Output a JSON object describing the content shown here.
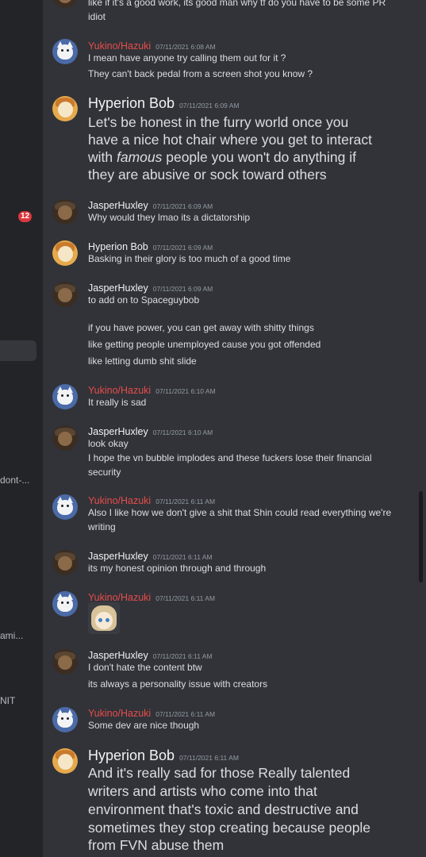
{
  "sidebar": {
    "badge": "12",
    "labels": [
      "dont-...",
      "ami...",
      "NIT"
    ]
  },
  "colors": {
    "yukino": "#e74c4c",
    "default_name": "#f2f3f5",
    "timestamp": "#949ba4",
    "background": "#313338"
  },
  "messages": [
    {
      "id": "m0",
      "author": "",
      "timestamp": "",
      "lines": [
        "like if it's a good work, its good man why tf do you have to be some PR",
        "idiot"
      ],
      "big": false,
      "avatar": "jasper-avatar"
    },
    {
      "id": "m1",
      "author": "Yukino/Hazuki",
      "timestamp": "07/11/2021 6:08 AM",
      "lines": [
        "I mean have anyone try calling them out for it ?",
        "They can't back pedal from a screen shot you know ?"
      ],
      "big": false,
      "avatar": "wolf-avatar"
    },
    {
      "id": "m2",
      "author": "Hyperion Bob",
      "timestamp": "07/11/2021 6:09 AM",
      "lines": [
        "Let's be honest in the furry world once you",
        "have a nice hot chair where you get to interact",
        "with famous people you won't do anything if",
        "they are abusive or sock toward others"
      ],
      "big": true,
      "avatar": "bob-avatar"
    },
    {
      "id": "m3",
      "author": "JasperHuxley",
      "timestamp": "07/11/2021 6:09 AM",
      "lines": [
        "Why would they lmao its a dictatorship"
      ],
      "big": false,
      "avatar": "jasper-avatar"
    },
    {
      "id": "m4",
      "author": "Hyperion Bob",
      "timestamp": "07/11/2021 6:09 AM",
      "lines": [
        "Basking in their glory is too much of a good time"
      ],
      "big": false,
      "avatar": "bob-avatar"
    },
    {
      "id": "m5",
      "author": "JasperHuxley",
      "timestamp": "07/11/2021 6:09 AM",
      "lines": [
        "to add on to Spaceguybob",
        "if you have power, you can get away with shitty things",
        "like getting people unemployed cause you got offended",
        "like letting dumb shit slide"
      ],
      "big": false,
      "avatar": "jasper-avatar"
    },
    {
      "id": "m6",
      "author": "Yukino/Hazuki",
      "timestamp": "07/11/2021 6:10 AM",
      "lines": [
        "It really is sad"
      ],
      "big": false,
      "avatar": "wolf-avatar"
    },
    {
      "id": "m7",
      "author": "JasperHuxley",
      "timestamp": "07/11/2021 6:10 AM",
      "lines": [
        "look okay",
        "I hope the vn bubble implodes and these fuckers lose their financial",
        "security"
      ],
      "big": false,
      "avatar": "jasper-avatar"
    },
    {
      "id": "m8",
      "author": "Yukino/Hazuki",
      "timestamp": "07/11/2021 6:11 AM",
      "lines": [
        "Also I like how we don't give a shit that Shin could read everything we're",
        "writing"
      ],
      "big": false,
      "avatar": "wolf-avatar"
    },
    {
      "id": "m9",
      "author": "JasperHuxley",
      "timestamp": "07/11/2021 6:11 AM",
      "lines": [
        "its my honest opinion through and through"
      ],
      "big": false,
      "avatar": "jasper-avatar"
    },
    {
      "id": "m10",
      "author": "Yukino/Hazuki",
      "timestamp": "07/11/2021 6:11 AM",
      "lines": [],
      "big": false,
      "avatar": "wolf-avatar",
      "emote": "anime-girl-emote"
    },
    {
      "id": "m11",
      "author": "JasperHuxley",
      "timestamp": "07/11/2021 6:11 AM",
      "lines": [
        "I don't hate the content btw",
        "its always a personality issue with creators"
      ],
      "big": false,
      "avatar": "jasper-avatar"
    },
    {
      "id": "m12",
      "author": "Yukino/Hazuki",
      "timestamp": "07/11/2021 6:11 AM",
      "lines": [
        "Some dev are nice though"
      ],
      "big": false,
      "avatar": "wolf-avatar"
    },
    {
      "id": "m13",
      "author": "Hyperion Bob",
      "timestamp": "07/11/2021 6:11 AM",
      "lines": [
        "And it's really sad for those Really talented",
        "writers and artists who come into that",
        "environment that's toxic and destructive and",
        "sometimes they stop creating because people",
        "from FVN abuse them"
      ],
      "big": true,
      "avatar": "bob-avatar"
    }
  ]
}
